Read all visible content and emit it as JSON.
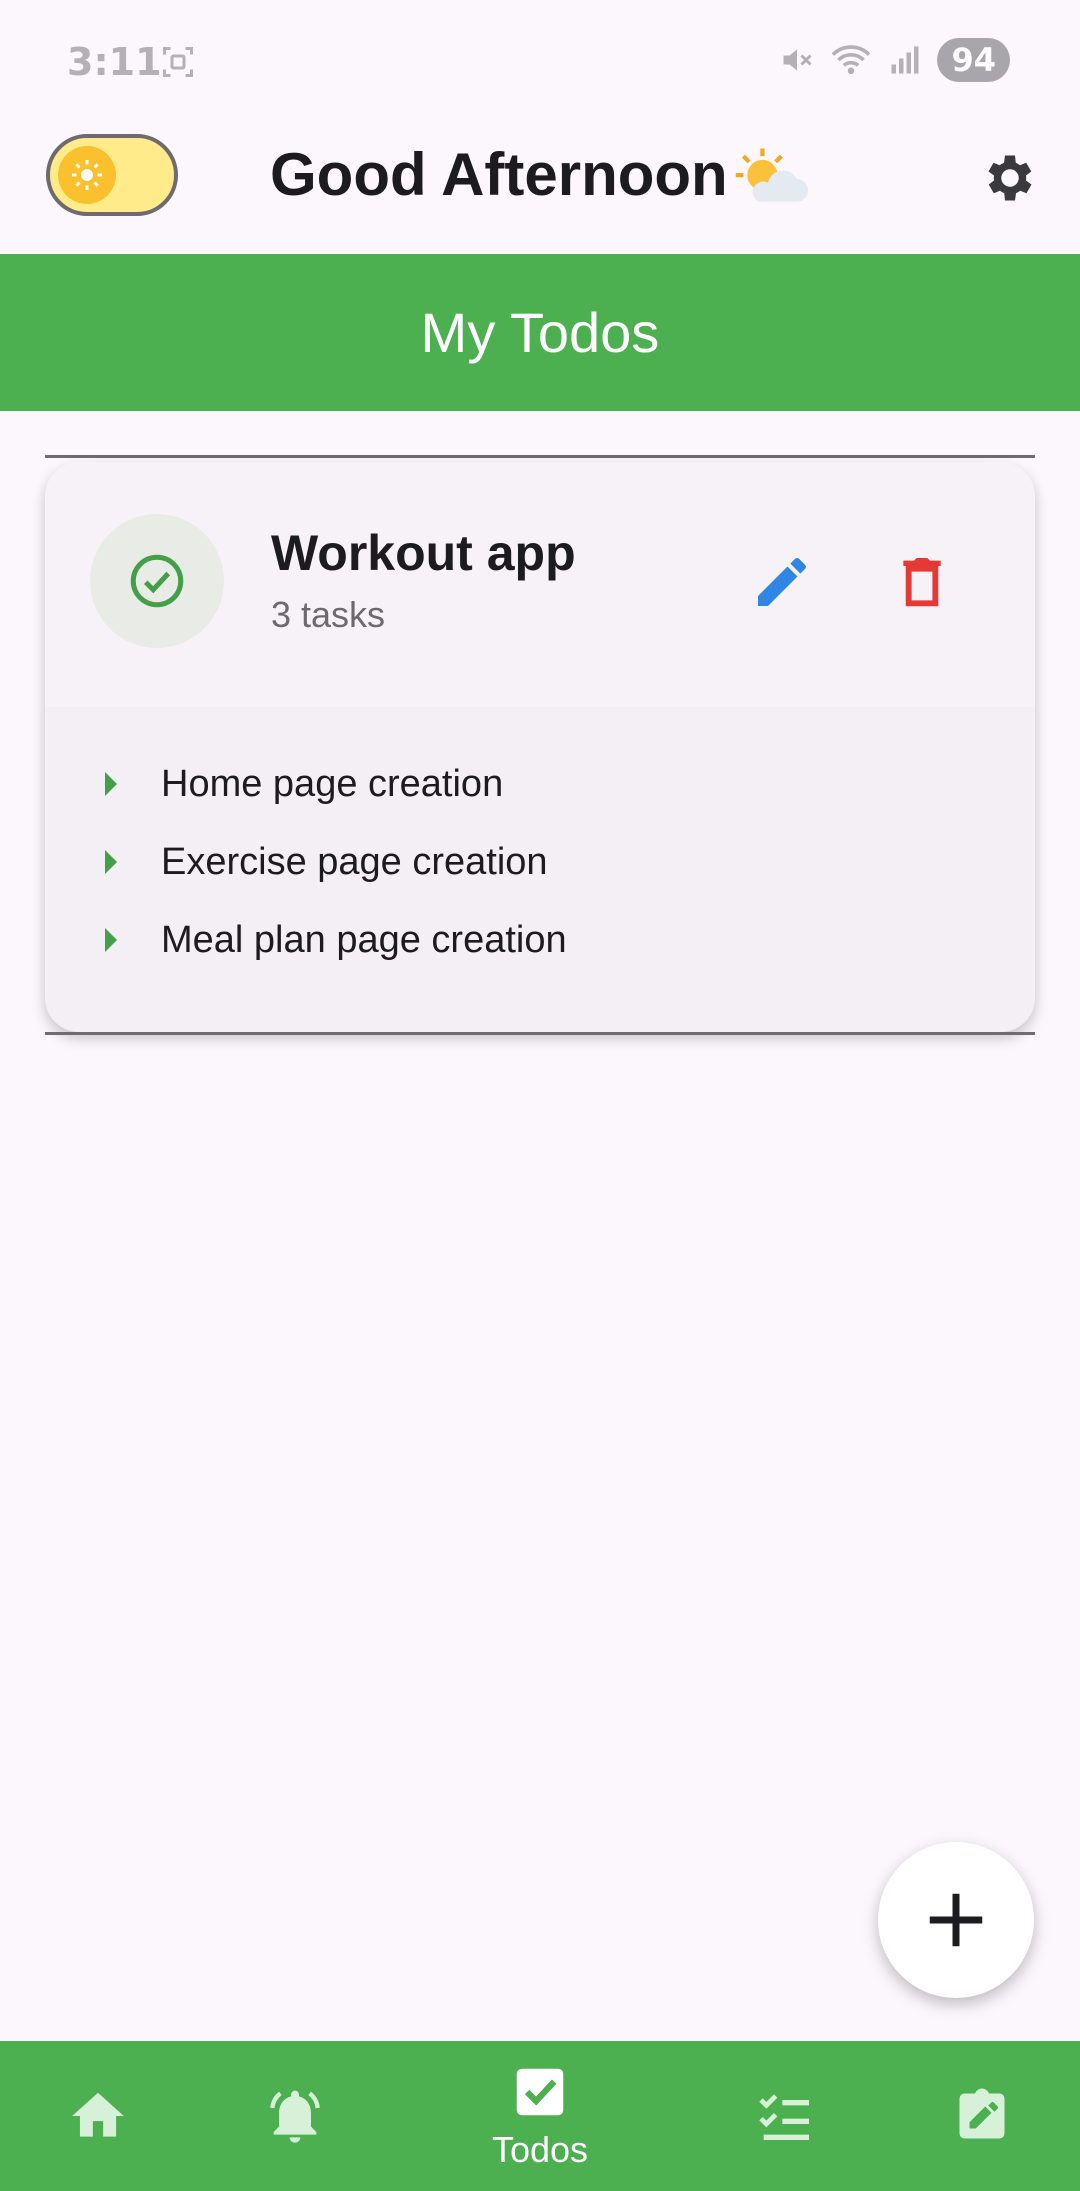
{
  "status_bar": {
    "time": "3:11",
    "battery": "94"
  },
  "header": {
    "greeting": "Good Afternoon"
  },
  "title_bar": {
    "title": "My Todos"
  },
  "card": {
    "title": "Workout app",
    "subtitle": "3 tasks",
    "tasks": [
      "Home page creation",
      "Exercise page creation",
      "Meal plan page creation"
    ]
  },
  "bottom_nav": {
    "active_label": "Todos"
  },
  "colors": {
    "primary": "#4caf50",
    "edit": "#2f86e4",
    "delete": "#e53935",
    "toggle_bg": "#ffeb8a",
    "sun": "#fbc02d"
  },
  "icons": {
    "settings": "gear-icon",
    "edit": "pencil-icon",
    "delete": "trash-icon",
    "fab": "plus-icon",
    "nav": [
      "home-icon",
      "bell-icon",
      "checkbox-icon",
      "checklist-icon",
      "edit-note-icon"
    ]
  }
}
